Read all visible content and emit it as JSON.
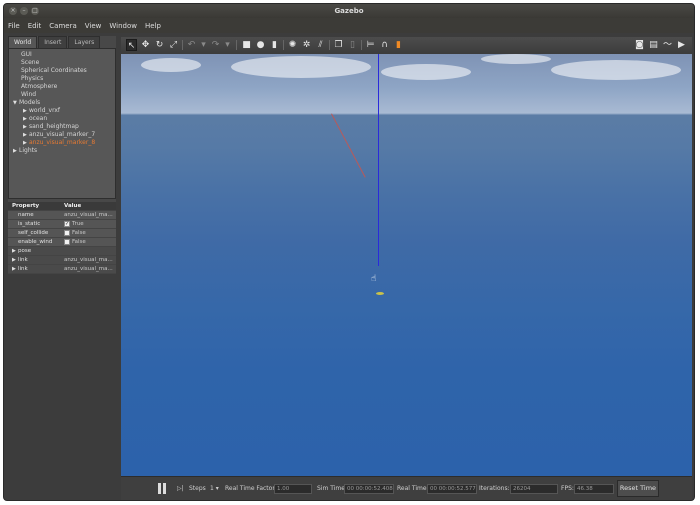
{
  "window": {
    "title": "Gazebo"
  },
  "menu": [
    "File",
    "Edit",
    "Camera",
    "View",
    "Window",
    "Help"
  ],
  "left_panel": {
    "tabs": [
      "World",
      "Insert",
      "Layers"
    ],
    "active_tab": "World",
    "tree": {
      "items": [
        "GUI",
        "Scene",
        "Spherical Coordinates",
        "Physics",
        "Atmosphere",
        "Wind"
      ],
      "models_label": "Models",
      "models": [
        "world_vrxf",
        "ocean",
        "sand_heightmap",
        "anzu_visual_marker_7",
        "anzu_visual_marker_8"
      ],
      "selected_model": "anzu_visual_marker_8",
      "lights_label": "Lights"
    },
    "properties": {
      "header": {
        "key": "Property",
        "value": "Value"
      },
      "rows": [
        {
          "key": "name",
          "value": "anzu_visual_ma..."
        },
        {
          "key": "is_static",
          "value": "True",
          "checked": true
        },
        {
          "key": "self_collide",
          "value": "False",
          "checked": false
        },
        {
          "key": "enable_wind",
          "value": "False",
          "checked": false
        },
        {
          "key": "pose",
          "value": "",
          "expandable": true
        },
        {
          "key": "link",
          "value": "anzu_visual_ma...",
          "expandable": true
        },
        {
          "key": "link",
          "value": "anzu_visual_ma...",
          "expandable": true
        }
      ]
    }
  },
  "toolbar": {
    "icons": [
      "select-arrow-icon",
      "translate-icon",
      "rotate-icon",
      "scale-icon",
      "undo-icon",
      "redo-icon",
      "box-icon",
      "sphere-icon",
      "cylinder-icon",
      "point-light-icon",
      "spot-light-icon",
      "directional-light-icon",
      "copy-icon",
      "paste-icon",
      "align-icon",
      "snap-icon",
      "orange-marker-icon",
      "screenshot-icon",
      "log-icon",
      "plot-icon",
      "video-icon"
    ]
  },
  "bottom_bar": {
    "steps_label": "Steps",
    "steps_value": "1",
    "rtf_label": "Real Time Factor:",
    "rtf_value": "1.00",
    "sim_time_label": "Sim Time:",
    "sim_time_value": "00 00:00:52.408",
    "real_time_label": "Real Time:",
    "real_time_value": "00 00:00:52.577",
    "iterations_label": "Iterations:",
    "iterations_value": "26204",
    "fps_label": "FPS:",
    "fps_value": "46.38",
    "reset_label": "Reset Time"
  }
}
